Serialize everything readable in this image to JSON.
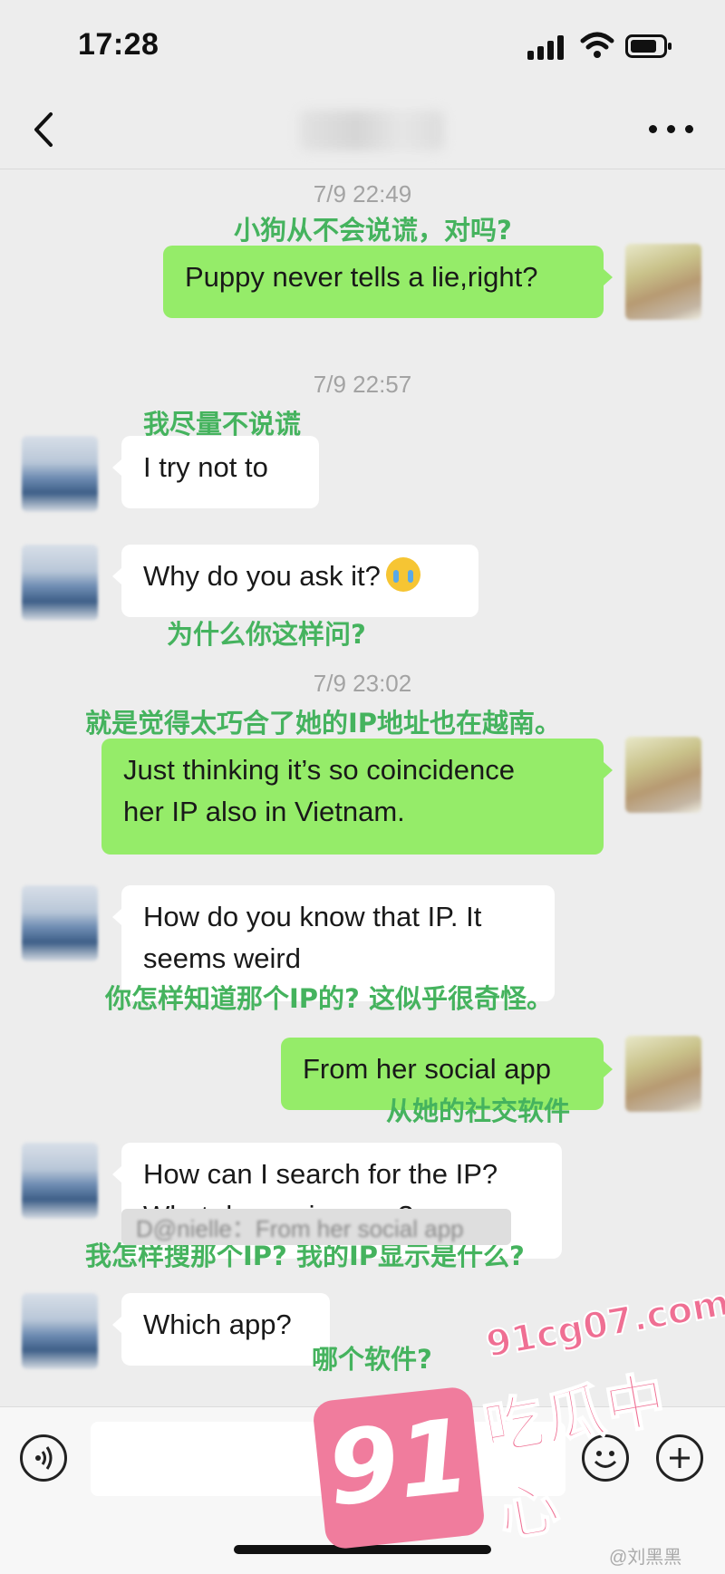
{
  "status_bar": {
    "time": "17:28"
  },
  "nav": {
    "back_icon": "chevron-left-icon",
    "more_icon": "ellipsis-icon"
  },
  "messages": [
    {
      "type": "timestamp",
      "text": "7/9 22:49"
    },
    {
      "type": "caption",
      "text": "小狗从不会说谎，对吗?"
    },
    {
      "type": "out",
      "text": "Puppy never tells a lie,right?"
    },
    {
      "type": "timestamp",
      "text": "7/9 22:57"
    },
    {
      "type": "caption",
      "text": "我尽量不说谎"
    },
    {
      "type": "in",
      "text": "I try not to"
    },
    {
      "type": "in",
      "text": "Why do you ask it?"
    },
    {
      "type": "caption",
      "text": "为什么你这样问?"
    },
    {
      "type": "timestamp",
      "text": "7/9 23:02"
    },
    {
      "type": "caption",
      "text": "就是觉得太巧合了她的IP地址也在越南。"
    },
    {
      "type": "out",
      "lines": [
        "Just thinking it’s so coincidence",
        "her IP also in Vietnam."
      ]
    },
    {
      "type": "in",
      "lines": [
        "How do you know that IP. It",
        "seems weird"
      ]
    },
    {
      "type": "caption",
      "text": "你怎样知道那个IP的? 这似乎很奇怪。"
    },
    {
      "type": "out",
      "text": "From her social app"
    },
    {
      "type": "caption",
      "text": "从她的社交软件"
    },
    {
      "type": "in",
      "lines": [
        "How can I search for the IP?",
        "What does mine say?"
      ]
    },
    {
      "type": "caption",
      "text": "我怎样搜那个IP? 我的IP显示是什么?"
    },
    {
      "type": "in",
      "text": "Which app?"
    },
    {
      "type": "caption",
      "text": "哪个软件?"
    }
  ],
  "quote_preview": "D@nielle：From her social app",
  "watermark": {
    "url": "91cg07.com",
    "brand_number": "91",
    "brand_cn": "吃瓜中心",
    "signature": "@刘黑黑"
  },
  "colors": {
    "outgoing": "#95ec69",
    "incoming": "#ffffff",
    "caption": "#45b35e",
    "watermark": "#ef6f93"
  }
}
